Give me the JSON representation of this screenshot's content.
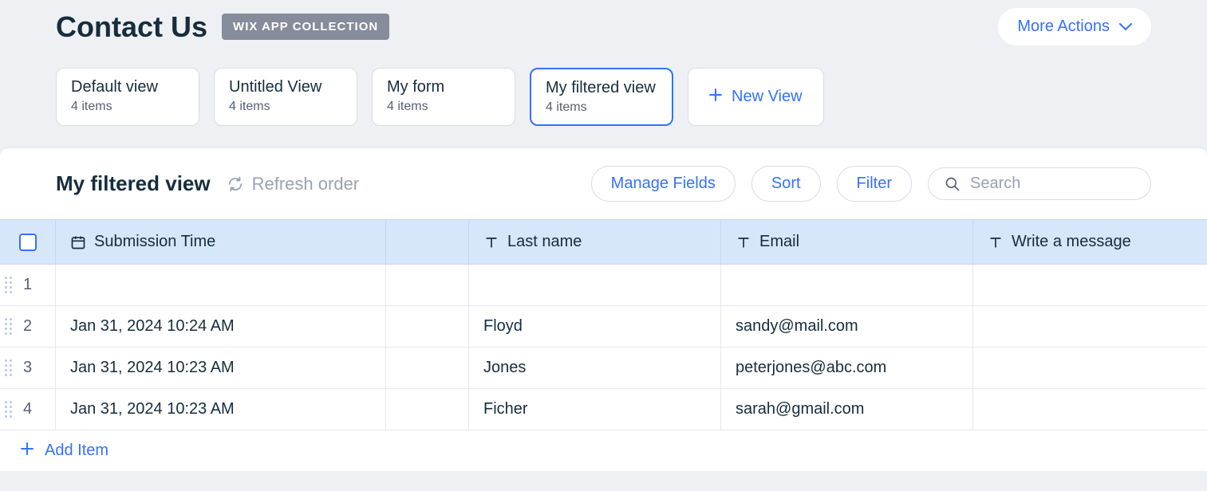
{
  "page": {
    "title": "Contact Us",
    "badge": "WIX APP COLLECTION",
    "more_actions_label": "More Actions"
  },
  "tabs": [
    {
      "label": "Default view",
      "count": "4 items",
      "active": false
    },
    {
      "label": "Untitled View",
      "count": "4 items",
      "active": false
    },
    {
      "label": "My form",
      "count": "4 items",
      "active": false
    },
    {
      "label": "My filtered view",
      "count": "4 items",
      "active": true
    }
  ],
  "new_view_label": "New View",
  "toolbar": {
    "view_title": "My filtered view",
    "refresh_label": "Refresh order",
    "manage_fields_label": "Manage Fields",
    "sort_label": "Sort",
    "filter_label": "Filter",
    "search_placeholder": "Search"
  },
  "columns": {
    "submission_time": "Submission Time",
    "last_name": "Last name",
    "email": "Email",
    "write_message": "Write a message"
  },
  "rows": [
    {
      "num": "1",
      "submission_time": "",
      "last_name": "",
      "email": "",
      "message": ""
    },
    {
      "num": "2",
      "submission_time": "Jan 31, 2024 10:24 AM",
      "last_name": "Floyd",
      "email": "sandy@mail.com",
      "message": ""
    },
    {
      "num": "3",
      "submission_time": "Jan 31, 2024 10:23 AM",
      "last_name": "Jones",
      "email": "peterjones@abc.com",
      "message": ""
    },
    {
      "num": "4",
      "submission_time": "Jan 31, 2024 10:23 AM",
      "last_name": "Ficher",
      "email": "sarah@gmail.com",
      "message": ""
    }
  ],
  "add_item_label": "Add Item"
}
